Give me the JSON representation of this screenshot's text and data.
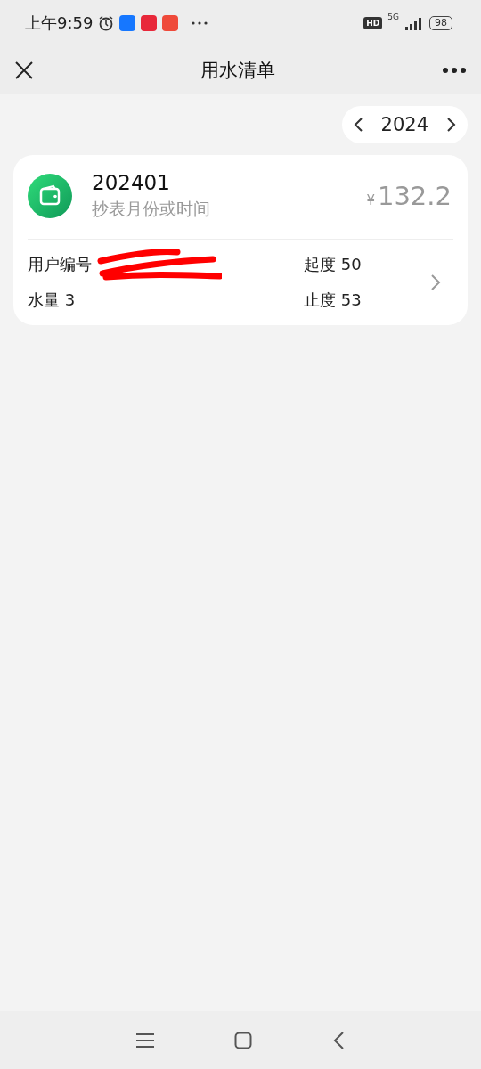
{
  "status_bar": {
    "time": "上午9:59",
    "network": "5G",
    "hd": "HD",
    "battery": "98"
  },
  "nav": {
    "title": "用水清单"
  },
  "year_picker": {
    "year": "2024"
  },
  "bills": [
    {
      "period": "202401",
      "subtitle": "抄表月份或时间",
      "currency": "¥",
      "amount": "132.2",
      "user_label": "用户编号",
      "usage": "水量 3",
      "start": "起度 50",
      "end": "止度 53"
    }
  ]
}
